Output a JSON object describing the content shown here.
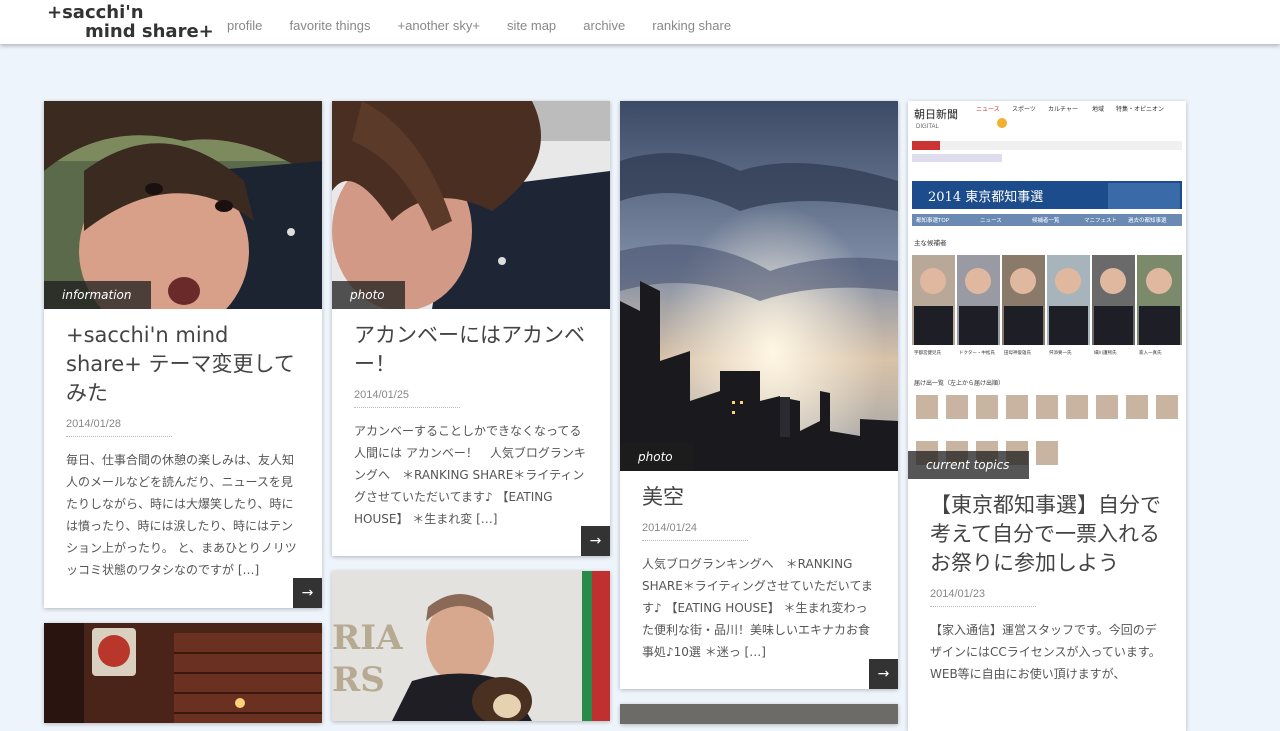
{
  "site": {
    "logo_line1": "+sacchi'n",
    "logo_line2": "mind share+"
  },
  "nav": {
    "items": [
      {
        "label": "profile"
      },
      {
        "label": "favorite things"
      },
      {
        "label": "+another sky+"
      },
      {
        "label": "site map"
      },
      {
        "label": "archive"
      },
      {
        "label": "ranking share"
      }
    ]
  },
  "posts": [
    {
      "category": "information",
      "title": "+sacchi'n mind share+ テーマ変更してみた",
      "date": "2014/01/28",
      "excerpt": "毎日、仕事合間の休憩の楽しみは、友人知人のメールなどを読んだり、ニュースを見たりしながら、時には大爆笑したり、時には憤ったり、時には涙したり、時にはテンション上がったり。 と、まあひとりノリツッコミ状態のワタシなのですが […]",
      "more_icon": "→"
    },
    {
      "category": "photo",
      "title": "アカンベーにはアカンベー！",
      "date": "2014/01/25",
      "excerpt": "アカンベーすることしかできなくなってる人間には アカンベー！　人気ブログランキングへ　＊RANKING SHARE＊ライティングさせていただいてます♪ 【EATING HOUSE】 ＊生まれ変 […]",
      "more_icon": "→"
    },
    {
      "category": "photo",
      "title": "美空",
      "date": "2014/01/24",
      "excerpt": "人気ブログランキングへ　＊RANKING SHARE＊ライティングさせていただいてます♪ 【EATING HOUSE】 ＊生まれ変わった便利な街・品川！美味しいエキナカお食事処♪10選 ＊迷っ […]",
      "more_icon": "→"
    },
    {
      "category": "current topics",
      "title": "【東京都知事選】自分で考えて自分で一票入れるお祭りに参加しよう",
      "date": "2014/01/23",
      "excerpt": "【家入通信】運営スタッフです。今回のデザインにはCCライセンスが入っています。WEB等に自由にお使い頂けますが、"
    }
  ],
  "news_thumb": {
    "paper_name": "朝日新聞",
    "paper_sub": "DIGITAL",
    "nav_items": [
      "ニュース",
      "スポーツ",
      "カルチャー",
      "地域",
      "特集・オピニオン"
    ],
    "banner": "2014 東京都知事選",
    "tabs": [
      "都知事選TOP",
      "ニュース",
      "候補者一覧",
      "マニフェスト",
      "過去の都知事選"
    ],
    "section1": "主な候補者",
    "section2": "届け出一覧（左上から届け出順）",
    "candidates": [
      "宇都宮健児氏",
      "ドクター・中松氏",
      "田母神俊雄氏",
      "舛添要一氏",
      "細川護熙氏",
      "家入一真氏"
    ]
  },
  "colors": {
    "background": "#eef4fb",
    "more_button": "#333333",
    "category_badge": "rgba(30,30,30,0.75)"
  }
}
